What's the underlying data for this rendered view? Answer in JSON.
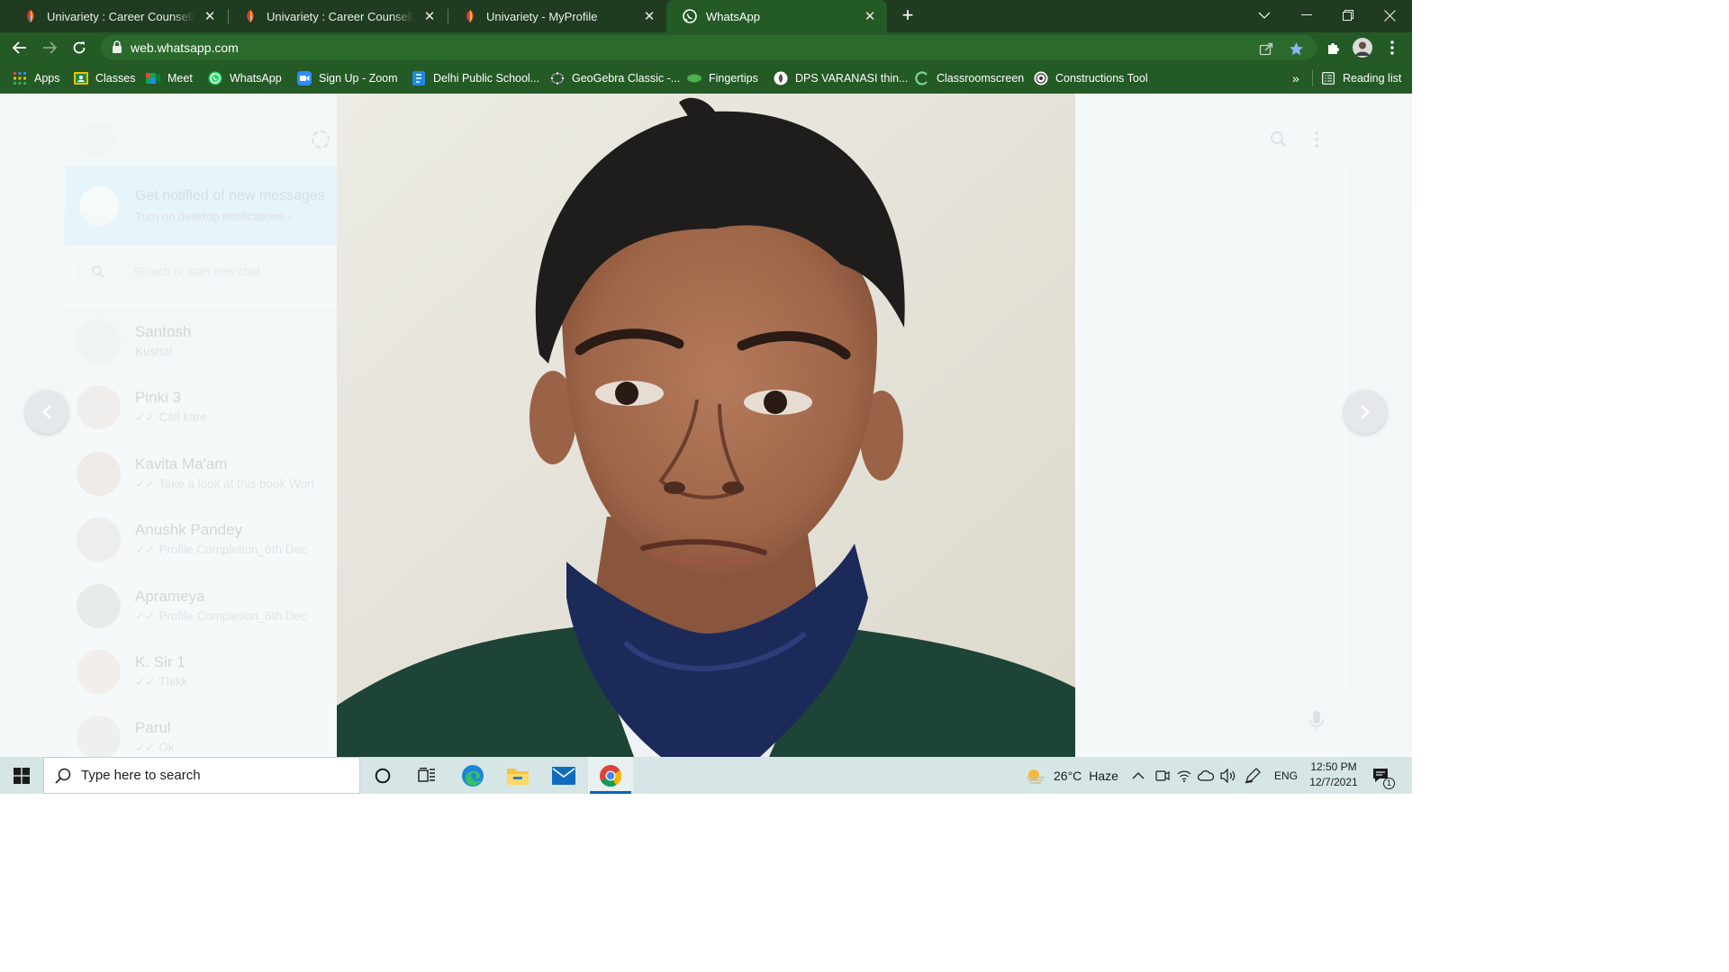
{
  "browser": {
    "tabs": [
      {
        "title": "Univariety : Career Counselling | C",
        "active": false,
        "favicon": "univariety-icon"
      },
      {
        "title": "Univariety : Career Counselling | C",
        "active": false,
        "favicon": "univariety-icon"
      },
      {
        "title": "Univariety - MyProfile",
        "active": false,
        "favicon": "univariety-icon"
      },
      {
        "title": "WhatsApp",
        "active": true,
        "favicon": "whatsapp-icon"
      }
    ],
    "new_tab_label": "+",
    "url": "web.whatsapp.com",
    "bookmarks": [
      {
        "label": "Apps",
        "icon": "apps-grid-icon"
      },
      {
        "label": "Classes",
        "icon": "classroom-icon"
      },
      {
        "label": "Meet",
        "icon": "meet-icon"
      },
      {
        "label": "WhatsApp",
        "icon": "whatsapp-icon"
      },
      {
        "label": "Sign Up - Zoom",
        "icon": "zoom-icon"
      },
      {
        "label": "Delhi Public School...",
        "icon": "school-icon"
      },
      {
        "label": "GeoGebra Classic -...",
        "icon": "geogebra-icon"
      },
      {
        "label": "Fingertips",
        "icon": "fingertips-icon"
      },
      {
        "label": "DPS VARANASI thin...",
        "icon": "dps-icon"
      },
      {
        "label": "Classroomscreen",
        "icon": "classroomscreen-icon"
      },
      {
        "label": "Constructions Tool",
        "icon": "constructions-icon"
      }
    ],
    "bookmarks_overflow": "»",
    "reading_list_label": "Reading list",
    "colors": {
      "frame": "#1f3b20",
      "toolbar": "#245a25"
    }
  },
  "whatsapp": {
    "notification_title": "Get notified of new messages",
    "notification_subtitle": "Turn on desktop notifications ›",
    "search_placeholder": "Search or start new chat",
    "chats": [
      {
        "name": "Santosh",
        "message": "Kushal"
      },
      {
        "name": "Pinki 3",
        "message": "✓✓ Call kare"
      },
      {
        "name": "Kavita Ma'am",
        "message": "✓✓ Take a look at this book Worl"
      },
      {
        "name": "Anushk Pandey",
        "message": "✓✓ Profile Completion_6th Dec"
      },
      {
        "name": "Aprameya",
        "message": "✓✓ Profile Completion_6th Dec"
      },
      {
        "name": "K. Sir 1",
        "message": "✓✓ Thikk"
      },
      {
        "name": "Parul",
        "message": "✓✓ Ok"
      }
    ],
    "viewer": {
      "prev_icon": "chevron-left-icon",
      "next_icon": "chevron-right-icon"
    }
  },
  "taskbar": {
    "search_placeholder": "Type here to search",
    "weather_temp": "26°C",
    "weather_desc": "Haze",
    "language": "ENG",
    "time": "12:50 PM",
    "date": "12/7/2021",
    "notification_count": "1"
  }
}
